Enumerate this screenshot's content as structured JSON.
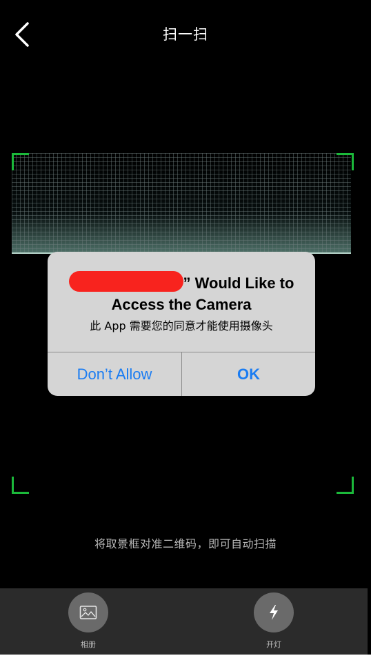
{
  "header": {
    "title": "扫一扫",
    "back_icon": "chevron-left-icon"
  },
  "scanner": {
    "frame_color": "#1bb93a",
    "hint": "将取景框对准二维码，即可自动扫描"
  },
  "alert": {
    "title_line1_suffix": "” Would Like to",
    "title_line2": "Access the Camera",
    "message": "此 App 需要您的同意才能使用摄像头",
    "deny_label": "Don’t Allow",
    "ok_label": "OK",
    "redaction_color": "#f8231e",
    "button_color": "#1a7cf2"
  },
  "bottom_bar": {
    "album_label": "相册",
    "album_icon": "image-icon",
    "light_label": "开灯",
    "light_icon": "lightning-icon"
  }
}
